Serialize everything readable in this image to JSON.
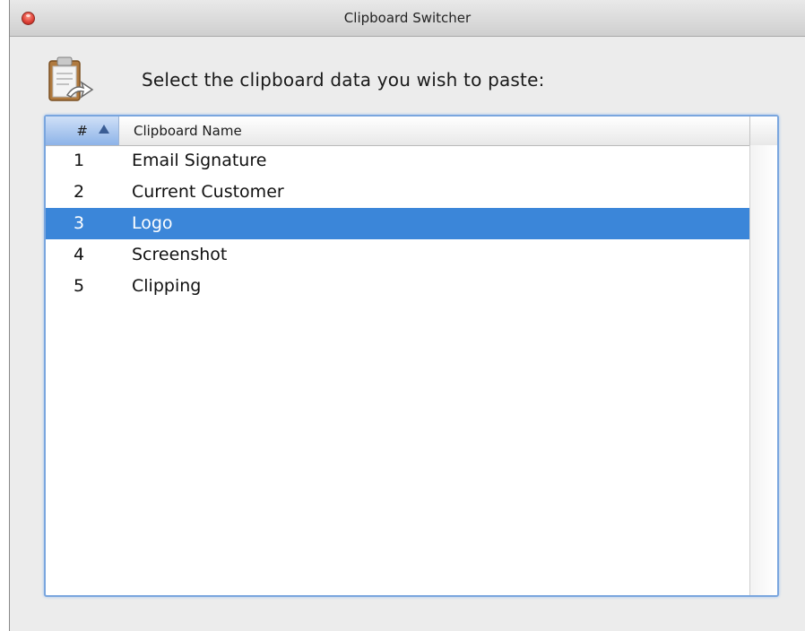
{
  "window": {
    "title": "Clipboard Switcher"
  },
  "prompt": "Select the clipboard data you wish to paste:",
  "table": {
    "columns": {
      "number": "#",
      "name": "Clipboard Name"
    },
    "sort": {
      "column": "#",
      "direction": "ascending"
    },
    "rows": [
      {
        "num": "1",
        "name": "Email Signature",
        "selected": false
      },
      {
        "num": "2",
        "name": "Current Customer",
        "selected": false
      },
      {
        "num": "3",
        "name": "Logo",
        "selected": true
      },
      {
        "num": "4",
        "name": "Screenshot",
        "selected": false
      },
      {
        "num": "5",
        "name": "Clipping",
        "selected": false
      }
    ]
  },
  "icons": {
    "app": "clipboard-paste-icon",
    "close": "close-icon",
    "sort": "sort-ascending-icon"
  },
  "colors": {
    "selection": "#3b86d9",
    "focus_ring": "#7aa6de",
    "close_button": "#e0443a"
  }
}
